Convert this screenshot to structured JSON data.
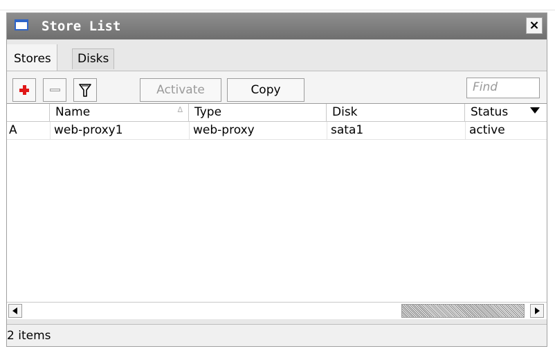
{
  "window": {
    "title": "Store List",
    "close_label": "×"
  },
  "tabs": [
    {
      "label": "Stores",
      "active": true
    },
    {
      "label": "Disks",
      "active": false
    }
  ],
  "toolbar": {
    "add_icon": "plus-icon",
    "remove_icon": "minus-icon",
    "filter_icon": "filter-icon",
    "activate_label": "Activate",
    "copy_label": "Copy",
    "find_placeholder": "Find"
  },
  "table": {
    "columns": [
      "",
      "Name",
      "Type",
      "Disk",
      "Status"
    ],
    "sort_indicator": "∆",
    "rows": [
      {
        "flag": "A",
        "name": "web-proxy1",
        "type": "web-proxy",
        "disk": "sata1",
        "status": "active"
      }
    ]
  },
  "status": {
    "items_text": "2 items"
  },
  "colors": {
    "title_bar": "#7f7f7f",
    "accent_red": "#e01818",
    "window_bg": "#e8e8e8"
  }
}
